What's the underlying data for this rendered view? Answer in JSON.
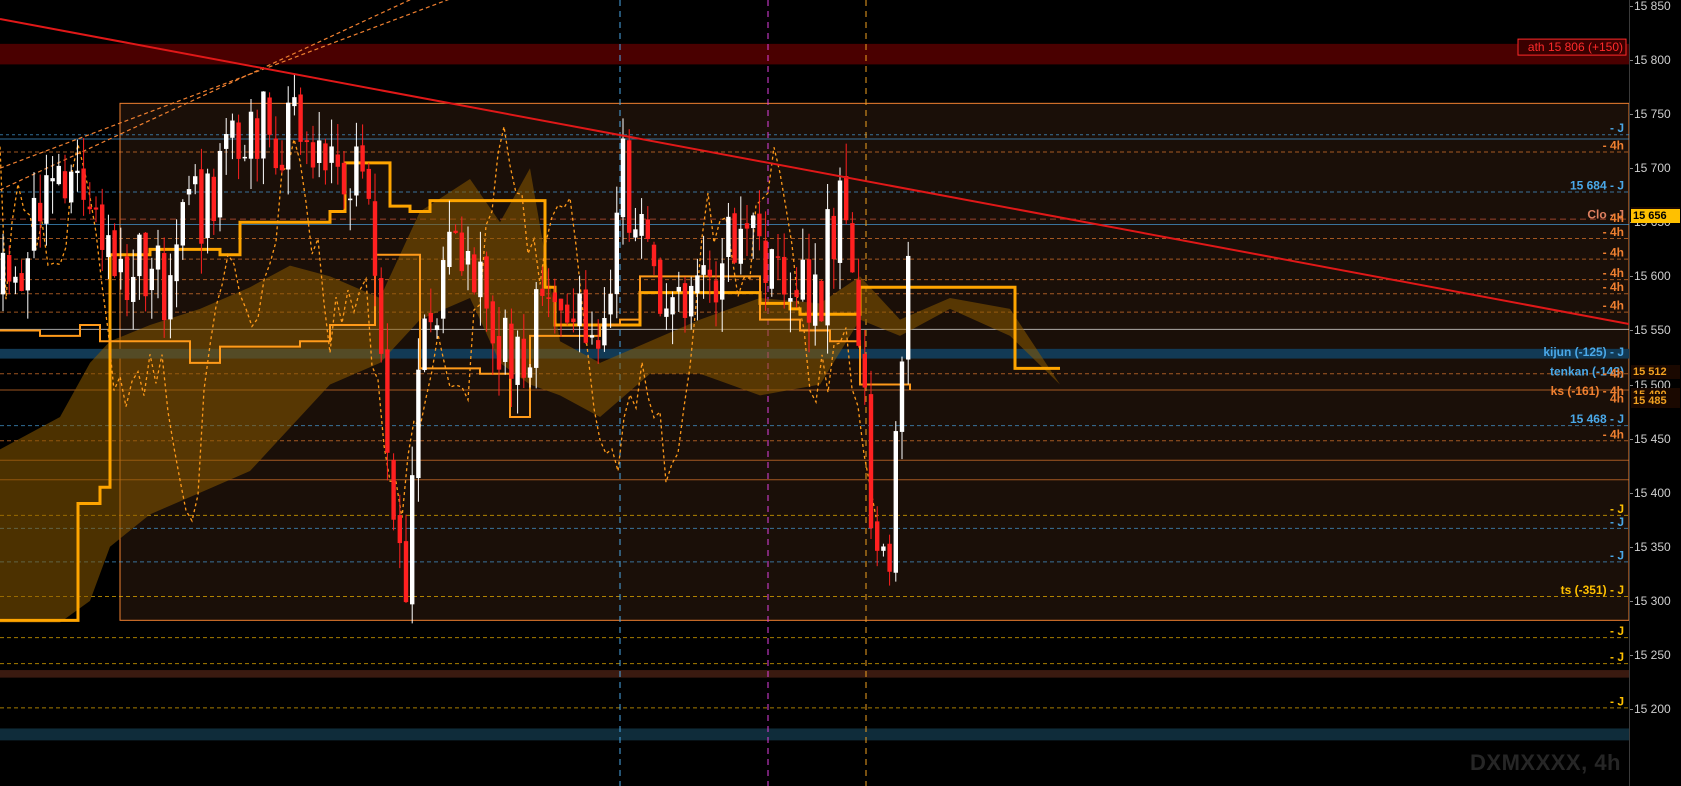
{
  "chart_data": {
    "type": "candlestick",
    "instrument": "DXMXXXX",
    "timeframe": "4h",
    "watermark": "DXMXXXX, 4h",
    "ylim": [
      15150,
      15860
    ],
    "y_ticks": [
      "15 850",
      "15 800",
      "15 750",
      "15 700",
      "15 650",
      "15 600",
      "15 550",
      "15 500",
      "15 450",
      "15 400",
      "15 350",
      "15 300",
      "15 250",
      "15 200"
    ],
    "y_tick_values": [
      15850,
      15800,
      15750,
      15700,
      15650,
      15600,
      15550,
      15500,
      15450,
      15400,
      15350,
      15300,
      15250,
      15200
    ],
    "last_price": {
      "label": "15 656",
      "value": 15656,
      "color": "#ffc000"
    },
    "price_tags": [
      {
        "label": "15 658",
        "value": 15658,
        "color": "#e06040"
      },
      {
        "label": "15 512",
        "value": 15512,
        "color": "#f0a020"
      },
      {
        "label": "15 490",
        "value": 15490,
        "color": "#f0a020"
      },
      {
        "label": "15 485",
        "value": 15485,
        "color": "#f0a020"
      }
    ],
    "annotations": [
      {
        "text": "ath 15 806 (+150)",
        "value": 15812,
        "color": "#ff2a2a",
        "boxed": true
      },
      {
        "text": "- J",
        "value": 15737,
        "color": "#4aa8e8"
      },
      {
        "text": "- 4h",
        "value": 15721,
        "color": "#f08030"
      },
      {
        "text": "15 684 - J",
        "value": 15684,
        "color": "#4aa8e8"
      },
      {
        "text": "Clo - J",
        "value": 15657,
        "color": "#e08060"
      },
      {
        "text": "4h",
        "value": 15654,
        "color": "#f08030"
      },
      {
        "text": "- 4h",
        "value": 15641,
        "color": "#f08030"
      },
      {
        "text": "- 4h",
        "value": 15622,
        "color": "#f08030"
      },
      {
        "text": "- 4h",
        "value": 15603,
        "color": "#f08030"
      },
      {
        "text": "- 4h",
        "value": 15590,
        "color": "#f08030"
      },
      {
        "text": "- 4h",
        "value": 15573,
        "color": "#f08030"
      },
      {
        "text": "kijun (-125) - J",
        "value": 15530,
        "color": "#4aa8e8"
      },
      {
        "text": "tenkan (-143)",
        "value": 15512,
        "color": "#4aa8e8"
      },
      {
        "text": "- 4h",
        "value": 15510,
        "color": "#f08030"
      },
      {
        "text": "ks (-161) - 4h",
        "value": 15494,
        "color": "#f08030"
      },
      {
        "text": "4h",
        "value": 15487,
        "color": "#f08030"
      },
      {
        "text": "15 468 - J",
        "value": 15468,
        "color": "#4aa8e8"
      },
      {
        "text": "- 4h",
        "value": 15454,
        "color": "#f08030"
      },
      {
        "text": "- J",
        "value": 15385,
        "color": "#ffc000"
      },
      {
        "text": "- J",
        "value": 15373,
        "color": "#4aa8e8"
      },
      {
        "text": "- J",
        "value": 15342,
        "color": "#4aa8e8"
      },
      {
        "text": "ts (-351) - J",
        "value": 15310,
        "color": "#ffc000"
      },
      {
        "text": "- J",
        "value": 15272,
        "color": "#ffc000"
      },
      {
        "text": "- J",
        "value": 15248,
        "color": "#ffc000"
      },
      {
        "text": "- J",
        "value": 15207,
        "color": "#ffc000"
      }
    ],
    "trendline": {
      "x": [
        0,
        1629
      ],
      "y": [
        15838,
        15556
      ],
      "color": "#e01818"
    },
    "colors": {
      "up": "#ffffff",
      "down": "#ff2020",
      "kijun": "#ffa500",
      "cloud": "#8a5a00"
    }
  }
}
